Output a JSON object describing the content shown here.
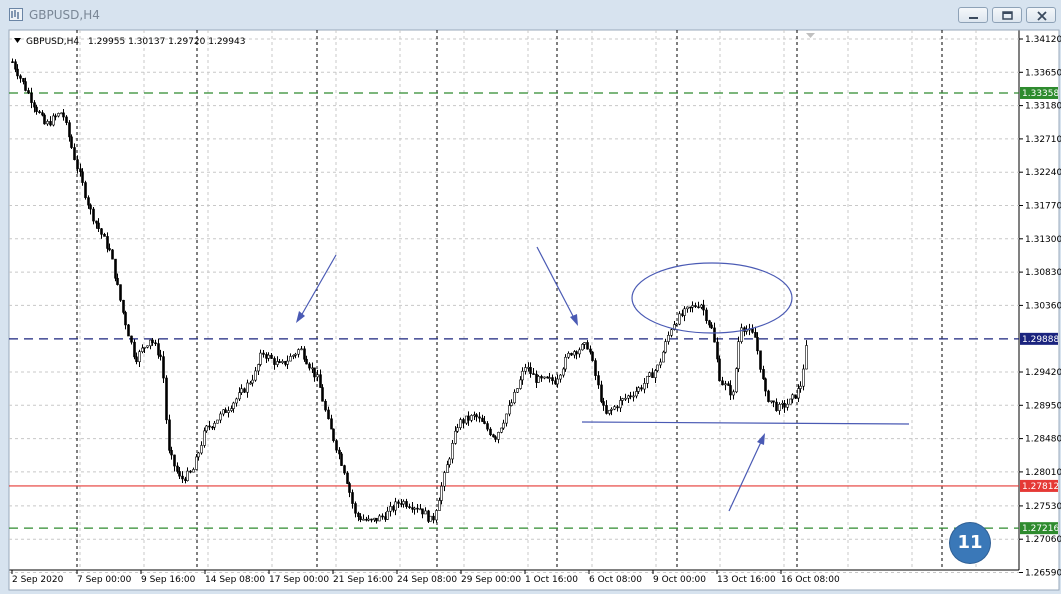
{
  "window": {
    "title": "GBPUSD,H4",
    "buttons": [
      "minimize",
      "restore",
      "close"
    ]
  },
  "chart_header": {
    "symbol": "GBPUSD,H4",
    "ohlc": "1.29955 1.30137 1.29720 1.29943"
  },
  "price_axis": {
    "ticks": [
      "1.34120",
      "1.33650",
      "1.33180",
      "1.32710",
      "1.32240",
      "1.31770",
      "1.31300",
      "1.30830",
      "1.30360",
      "1.29420",
      "1.28950",
      "1.28480",
      "1.28010",
      "1.27530",
      "1.27060",
      "1.26590"
    ]
  },
  "time_axis": {
    "ticks": [
      "2 Sep 2020",
      "7 Sep 00:00",
      "9 Sep 16:00",
      "14 Sep 08:00",
      "17 Sep 00:00",
      "21 Sep 16:00",
      "24 Sep 08:00",
      "29 Sep 00:00",
      "1 Oct 16:00",
      "6 Oct 08:00",
      "9 Oct 00:00",
      "13 Oct 16:00",
      "16 Oct 08:00"
    ]
  },
  "levels": [
    {
      "name": "green-level-top",
      "price": 1.33358,
      "label": "1.33358",
      "color": "#2e8b2e",
      "style": "dashed"
    },
    {
      "name": "blue-level",
      "price": 1.29888,
      "label": "1.29888",
      "color": "#1a237e",
      "style": "dashed"
    },
    {
      "name": "red-level",
      "price": 1.27812,
      "label": "1.27812",
      "color": "#e53935",
      "style": "solid"
    },
    {
      "name": "green-level-bottom",
      "price": 1.27216,
      "label": "1.27216",
      "color": "#2e8b2e",
      "style": "dashed"
    }
  ],
  "badge": {
    "text": "11"
  },
  "colors": {
    "candle": "#000000",
    "grid": "#c8c8c8",
    "annotation": "#4a5ab4",
    "badge": "#3a78b8"
  }
}
